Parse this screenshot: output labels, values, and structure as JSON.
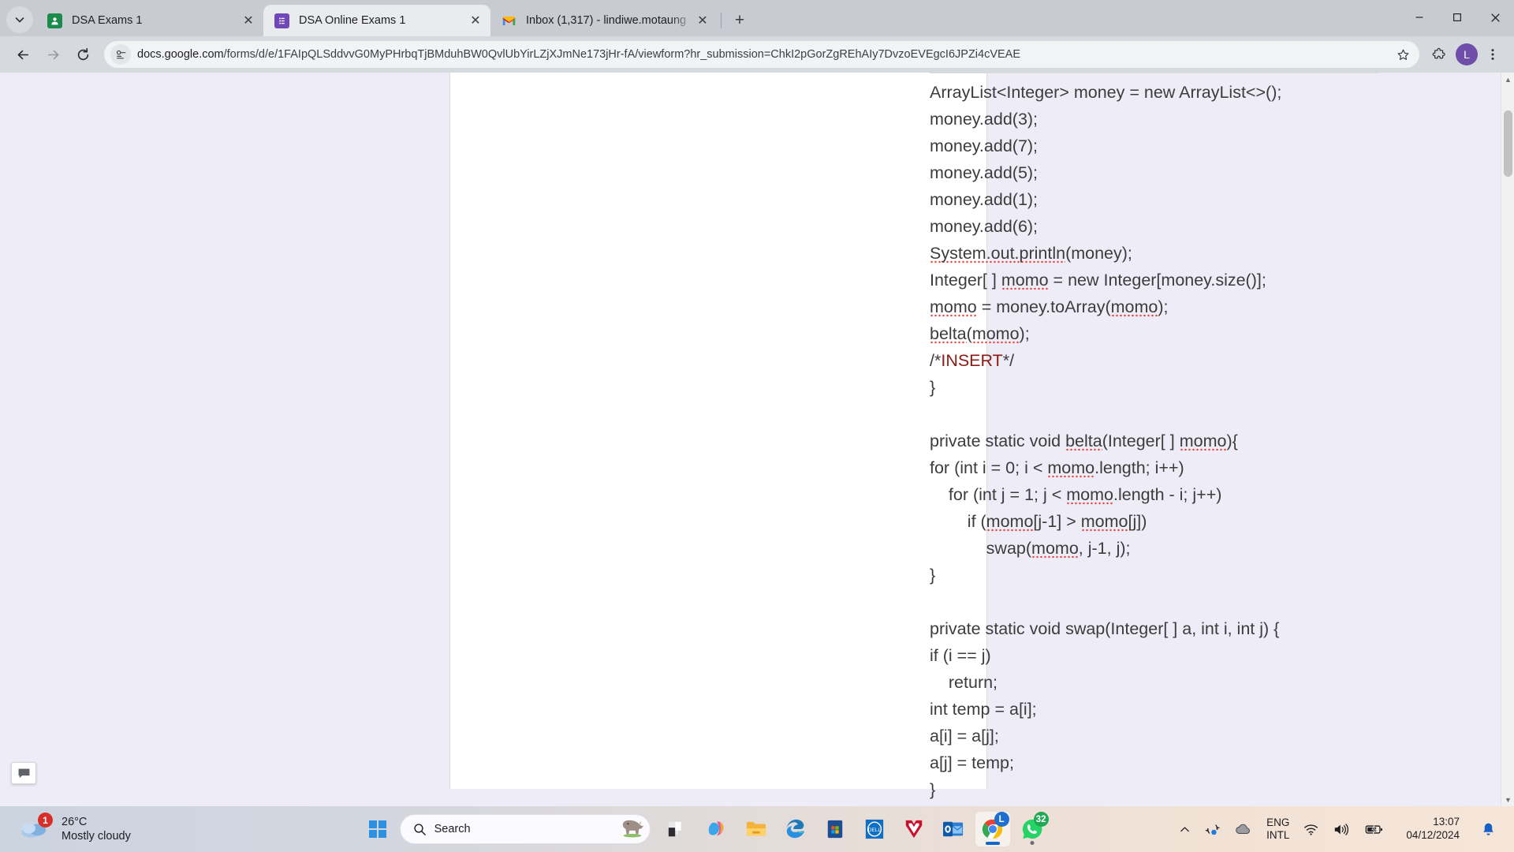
{
  "browser": {
    "tabs": [
      {
        "title": "DSA Exams 1",
        "favicon": "contacts-icon",
        "active": false
      },
      {
        "title": "DSA Online Exams 1",
        "favicon": "google-forms-icon",
        "active": true
      },
      {
        "title": "Inbox (1,317) - lindiwe.motaung",
        "favicon": "gmail-icon",
        "active": false
      }
    ],
    "tab_close_label": "✕",
    "new_tab_label": "+",
    "tab_list_icon": "chevron-down-icon",
    "window_controls": {
      "minimize": "—",
      "maximize": "☐",
      "close": "✕"
    },
    "nav": {
      "back": "←",
      "forward": "→",
      "reload": "↻"
    },
    "omnibox": {
      "site_info_icon": "page-info-icon",
      "url_host": "docs.google.com",
      "url_path": "/forms/d/e/1FAIpQLSddvvG0MyPHrbqTjBMduhBW0QvlUbYirLZjXJmNe173jHr-fA/viewform?hr_submission=ChkI2pGorZgREhAIy7DvzoEVEgcI6JPZi4cVEAE",
      "bookmark_icon": "star-icon",
      "extensions_icon": "extensions-puzzle-icon",
      "menu_icon": "three-dot-menu-icon",
      "profile_initial": "L"
    }
  },
  "page": {
    "feedback_icon": "feedback-icon",
    "scrollbar": {
      "up_arrow": "▲",
      "down_arrow": "▼"
    },
    "code_lines": [
      {
        "indent": 0,
        "text": "ArrayList<Integer> money = new ArrayList<>();"
      },
      {
        "indent": 0,
        "text": "money.add(3);"
      },
      {
        "indent": 0,
        "text": "money.add(7);"
      },
      {
        "indent": 0,
        "text": "money.add(5);"
      },
      {
        "indent": 0,
        "text": "money.add(1);"
      },
      {
        "indent": 0,
        "text": "money.add(6);"
      },
      {
        "indent": 0,
        "text": "System.out.println(money);"
      },
      {
        "indent": 0,
        "text": "Integer[ ] momo = new Integer[money.size()];"
      },
      {
        "indent": 0,
        "text": "momo = money.toArray(momo);"
      },
      {
        "indent": 0,
        "text": "belta(momo);"
      },
      {
        "indent": 0,
        "text": "/*INSERT*/"
      },
      {
        "indent": 0,
        "text": "}"
      },
      {
        "indent": 0,
        "text": ""
      },
      {
        "indent": 0,
        "text": "private static void belta(Integer[ ] momo){"
      },
      {
        "indent": 0,
        "text": "for (int i = 0; i < momo.length; i++)"
      },
      {
        "indent": 1,
        "text": "for (int j = 1; j < momo.length - i; j++)"
      },
      {
        "indent": 2,
        "text": "if (momo[j-1] > momo[j])"
      },
      {
        "indent": 3,
        "text": "swap(momo, j-1, j);"
      },
      {
        "indent": 0,
        "text": "}"
      },
      {
        "indent": 0,
        "text": ""
      },
      {
        "indent": 0,
        "text": "private static void swap(Integer[ ] a, int i, int j) {"
      },
      {
        "indent": 0,
        "text": "if (i == j)"
      },
      {
        "indent": 1,
        "text": "return;"
      },
      {
        "indent": 0,
        "text": "int temp = a[i];"
      },
      {
        "indent": 0,
        "text": "a[i] = a[j];"
      },
      {
        "indent": 0,
        "text": "a[j] = temp;"
      },
      {
        "indent": 0,
        "text": "}"
      }
    ],
    "insert_keyword": "INSERT",
    "insert_color": "#8c1b14"
  },
  "taskbar": {
    "weather": {
      "temperature": "26°C",
      "condition": "Mostly cloudy",
      "badge": "1",
      "icon": "cloud-icon"
    },
    "start_icon": "windows-start-icon",
    "search": {
      "placeholder": "Search",
      "icon": "search-icon",
      "widget_icon": "rhino-icon"
    },
    "apps": [
      {
        "name": "task-view-icon",
        "badge": null,
        "running": false
      },
      {
        "name": "copilot-icon",
        "badge": null,
        "running": false
      },
      {
        "name": "file-explorer-icon",
        "badge": null,
        "running": false
      },
      {
        "name": "microsoft-edge-icon",
        "badge": null,
        "running": true
      },
      {
        "name": "microsoft-store-icon",
        "badge": null,
        "running": false
      },
      {
        "name": "dell-icon",
        "badge": null,
        "running": false
      },
      {
        "name": "mcafee-icon",
        "badge": null,
        "running": false
      },
      {
        "name": "outlook-icon",
        "badge": null,
        "running": false
      },
      {
        "name": "google-chrome-icon",
        "badge": "L",
        "running": true
      },
      {
        "name": "whatsapp-icon",
        "badge": "32",
        "running": true
      }
    ],
    "tray": {
      "overflow_icon": "chevron-up-icon",
      "onedrive_sync_icon": "onedrive-sync-icon",
      "cloud_icon": "cloud-tray-icon",
      "language": {
        "line1": "ENG",
        "line2": "INTL"
      },
      "wifi_icon": "wifi-icon",
      "volume_icon": "speaker-icon",
      "battery_icon": "battery-charging-icon",
      "clock": {
        "time": "13:07",
        "date": "04/12/2024"
      },
      "notification_icon": "bell-icon"
    }
  }
}
